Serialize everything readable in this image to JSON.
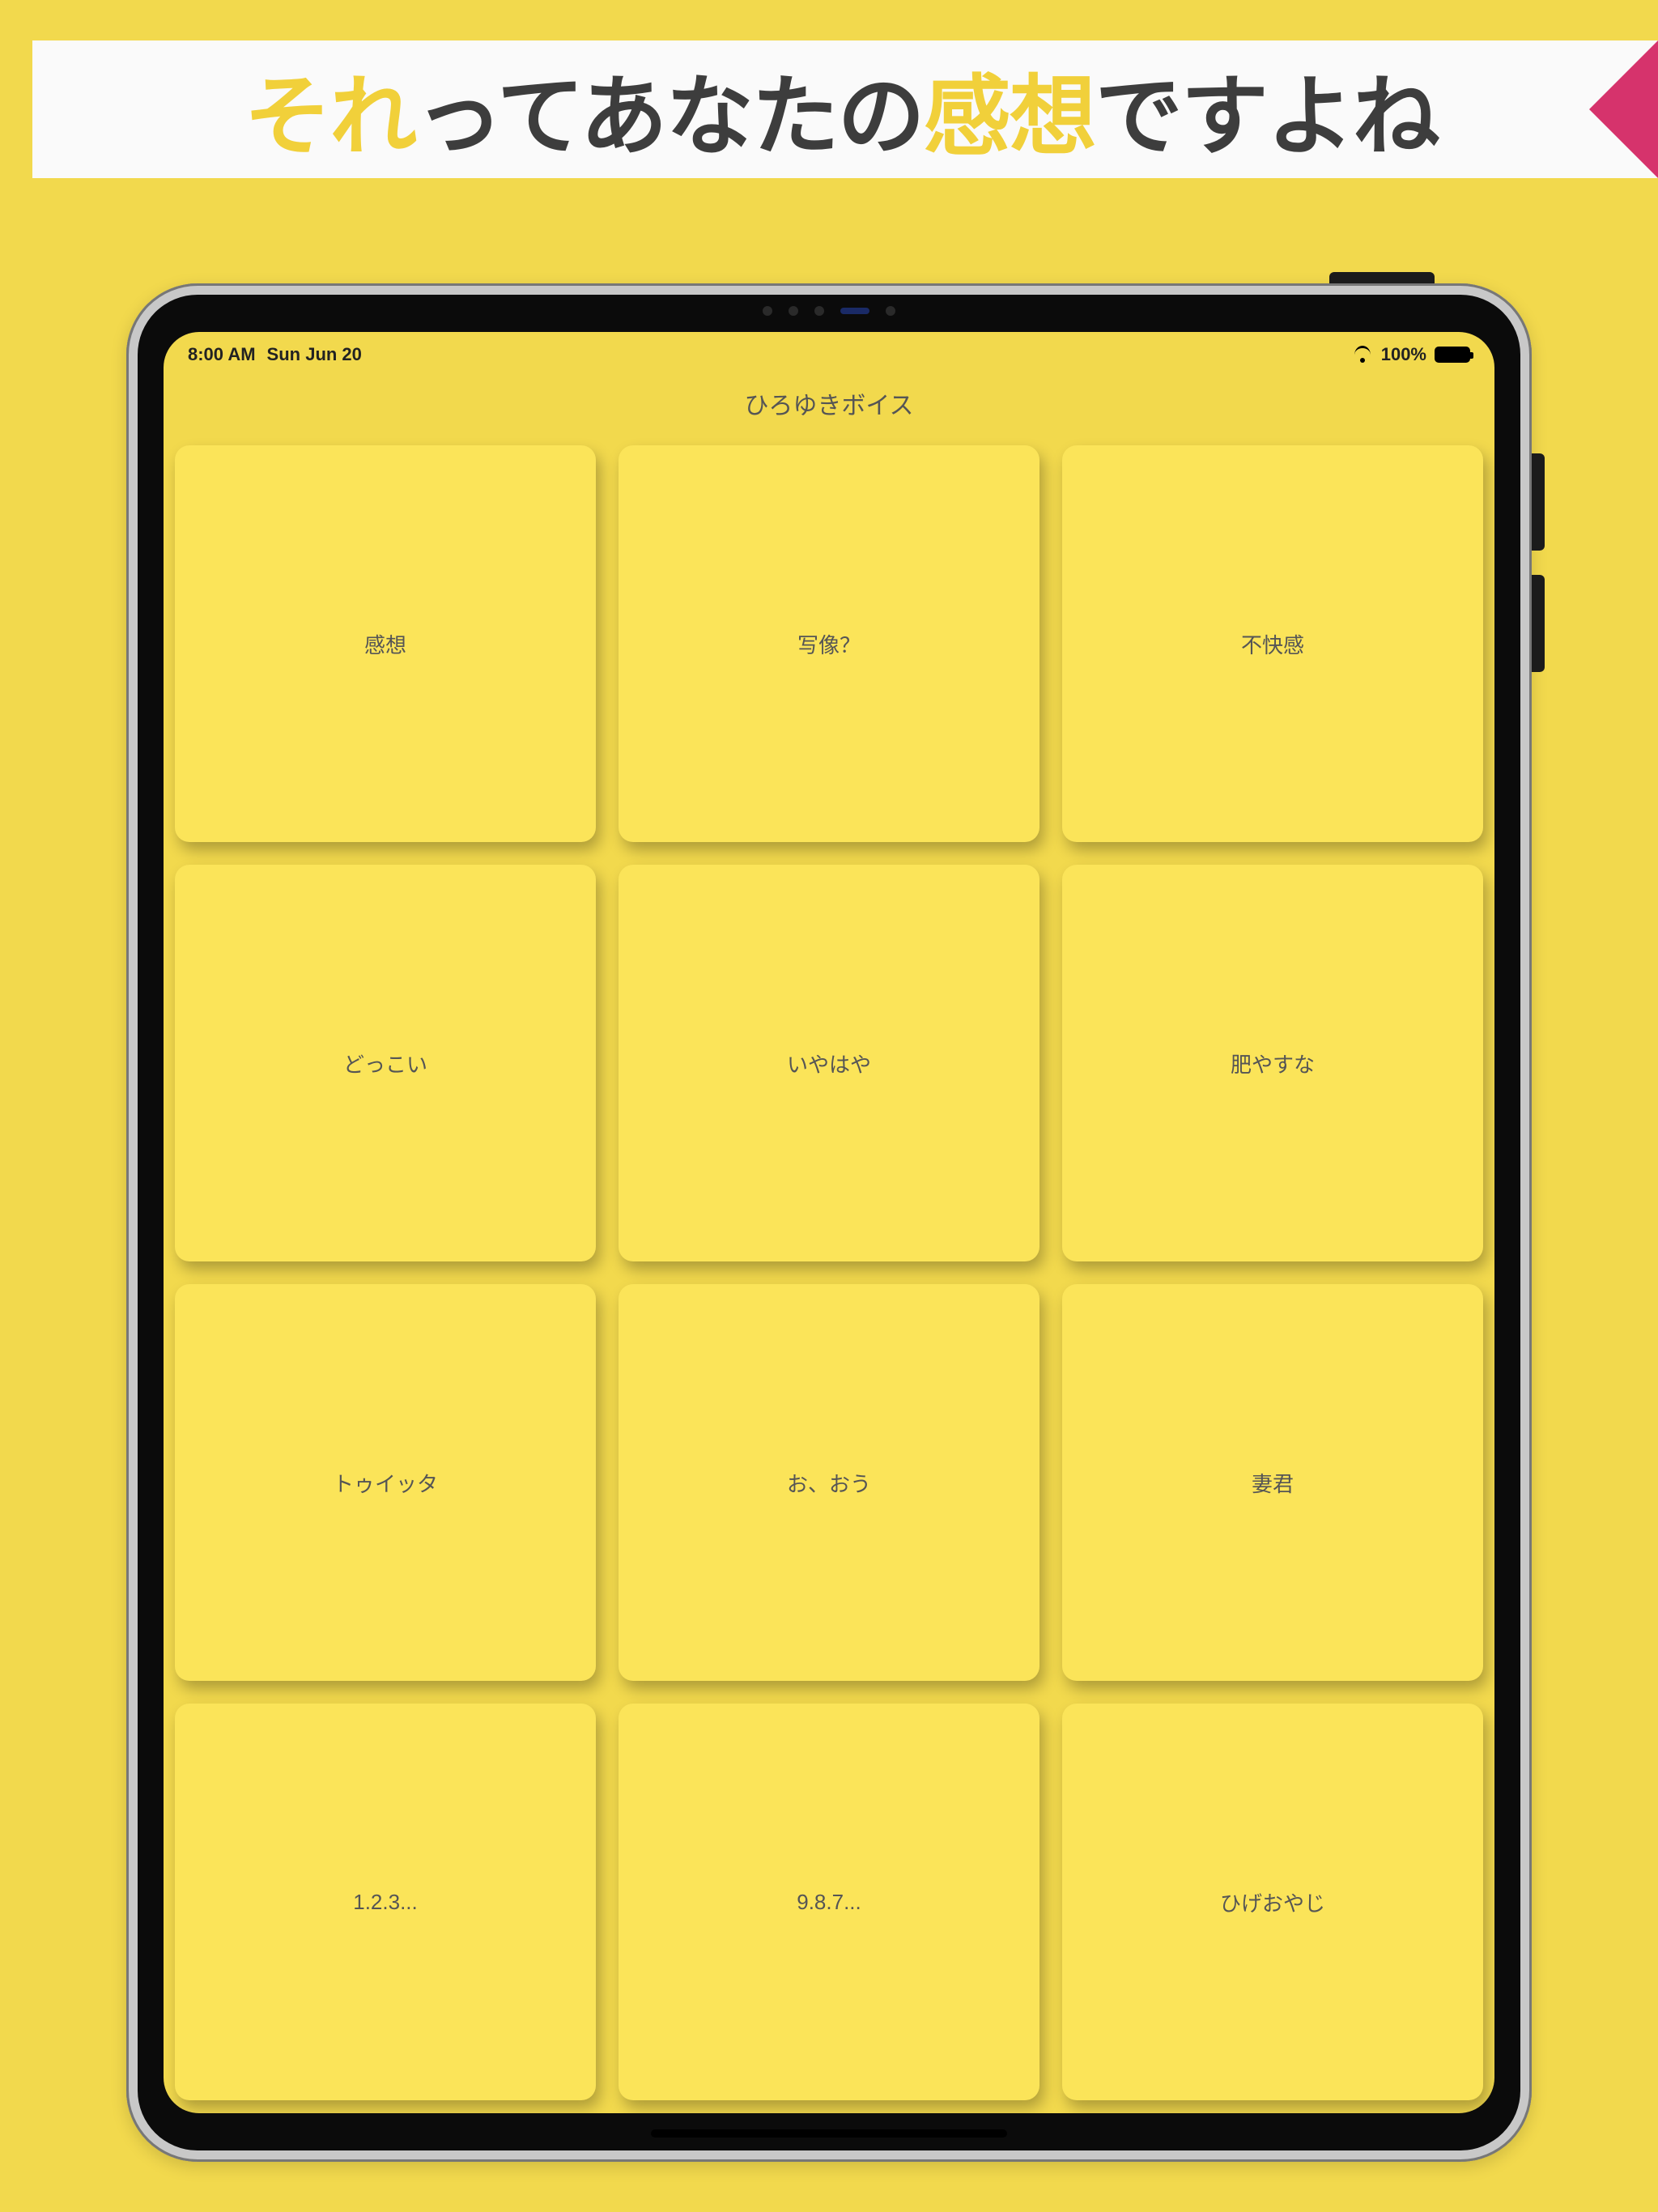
{
  "banner": {
    "seg1": "それ",
    "seg2": "ってあなたの",
    "seg3": "感想",
    "seg4": "ですよね"
  },
  "status": {
    "time": "8:00 AM",
    "date": "Sun Jun 20",
    "battery_pct": "100%"
  },
  "nav": {
    "title": "ひろゆきボイス"
  },
  "tiles": [
    "感想",
    "写像？",
    "不快感",
    "どっこい",
    "いやはや",
    "肥やすな",
    "トゥイッタ",
    "お、おう",
    "妻君",
    "1.2.3...",
    "9.8.7...",
    "ひげおやじ"
  ]
}
